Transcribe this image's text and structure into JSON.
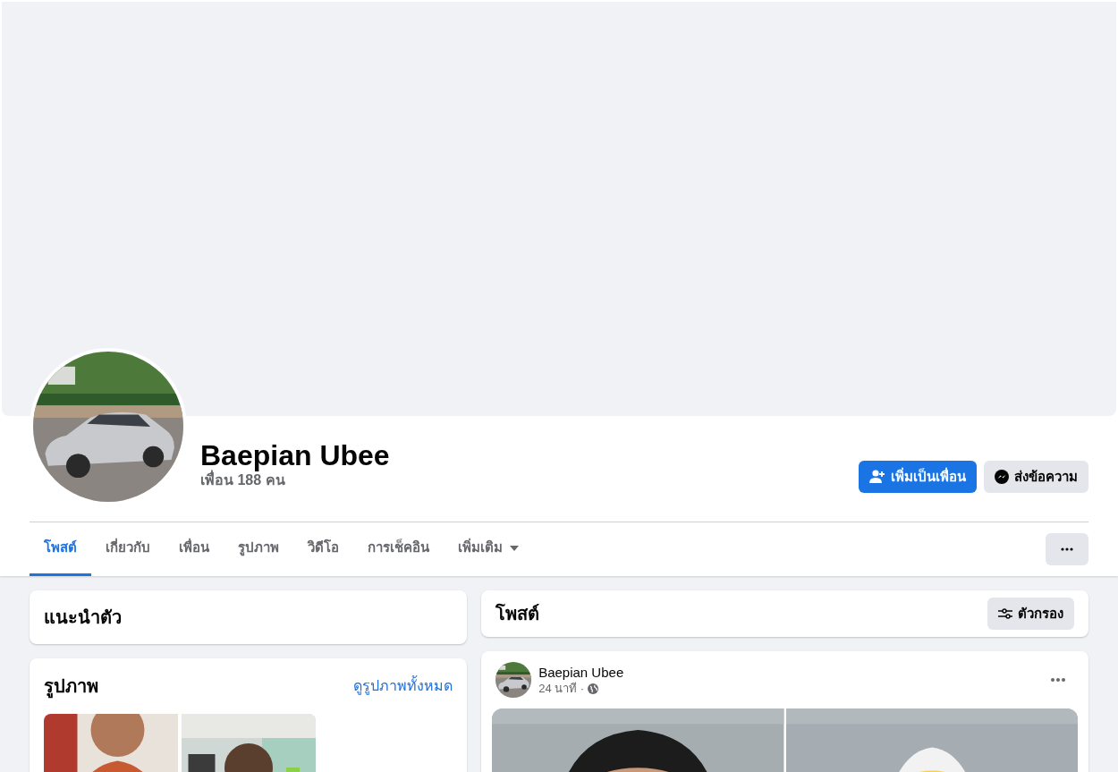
{
  "profile": {
    "name": "Baepian Ubee",
    "friends": "เพื่อน 188 คน"
  },
  "actions": [
    {
      "kind": "add_friend",
      "label": "เพิ่มเป็นเพื่อน"
    },
    {
      "kind": "message",
      "label": "ส่งข้อความ"
    }
  ],
  "tabs": [
    {
      "label": "โพสต์",
      "selected": true,
      "dropdown": false
    },
    {
      "label": "เกี่ยวกับ",
      "selected": false,
      "dropdown": false
    },
    {
      "label": "เพื่อน",
      "selected": false,
      "dropdown": false
    },
    {
      "label": "รูปภาพ",
      "selected": false,
      "dropdown": false
    },
    {
      "label": "วิดีโอ",
      "selected": false,
      "dropdown": false
    },
    {
      "label": "การเช็คอิน",
      "selected": false,
      "dropdown": false
    },
    {
      "label": "เพิ่มเติม",
      "selected": false,
      "dropdown": true
    }
  ],
  "intro": {
    "title": "แนะนำตัว"
  },
  "photos": {
    "title": "รูปภาพ",
    "link": "ดูรูปภาพทั้งหมด"
  },
  "posts_header": {
    "title": "โพสต์",
    "filter": "ตัวกรอง"
  },
  "post": {
    "author": "Baepian Ubee",
    "time": "24 นาที ·"
  }
}
